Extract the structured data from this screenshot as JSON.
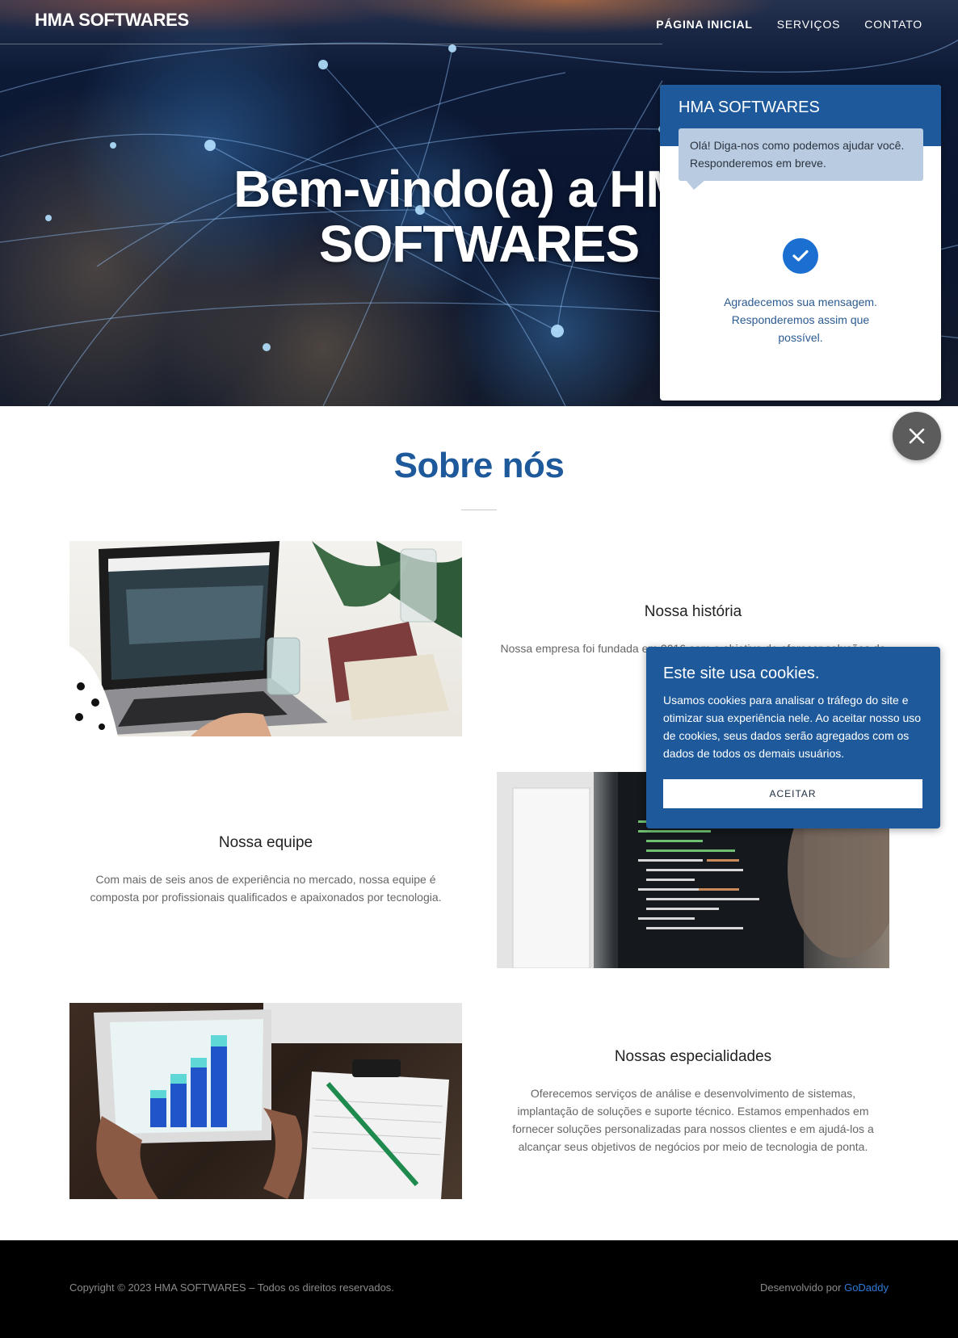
{
  "header": {
    "logo": "HMA SOFTWARES",
    "nav": [
      {
        "label": "PÁGINA INICIAL"
      },
      {
        "label": "SERVIÇOS"
      },
      {
        "label": "CONTATO"
      }
    ]
  },
  "hero": {
    "title": "Bem-vindo(a) a HMA\nSOFTWARES"
  },
  "chat": {
    "title": "HMA SOFTWARES",
    "bubble": "Olá! Diga-nos como podemos ajudar você. Responderemos em breve.",
    "thanks": "Agradecemos sua mensagem. Responderemos assim que possível.",
    "check_icon": "check-circle-icon"
  },
  "close_icon": "close-icon",
  "about": {
    "title": "Sobre nós",
    "blocks": [
      {
        "title": "Nossa história",
        "text": "Nossa empresa foi fundada em 2016 com o objetivo de oferecer soluções de TI para empresas."
      },
      {
        "title": "Nossa equipe",
        "text": "Com mais de seis anos de experiência no mercado, nossa equipe é composta por profissionais qualificados e apaixonados por tecnologia."
      },
      {
        "title": "Nossas especialidades",
        "text": "Oferecemos serviços de análise e desenvolvimento de sistemas, implantação de soluções e suporte técnico. Estamos empenhados em fornecer soluções personalizadas para nossos clientes e em ajudá-los a alcançar seus objetivos de negócios por meio de tecnologia de ponta."
      }
    ]
  },
  "cookie": {
    "title": "Este site usa cookies.",
    "text": "Usamos cookies para analisar o tráfego do site e otimizar sua experiência nele. Ao aceitar nosso uso de cookies, seus dados serão agregados com os dados de todos os demais usuários.",
    "button": "ACEITAR"
  },
  "footer": {
    "copyright": "Copyright © 2023 HMA SOFTWARES – Todos os direitos reservados.",
    "developed_by": "Desenvolvido por ",
    "developer_link": "GoDaddy"
  },
  "colors": {
    "brand_blue": "#1e5a9b",
    "link_blue": "#2d7ad6",
    "footer_bg": "#000000"
  }
}
